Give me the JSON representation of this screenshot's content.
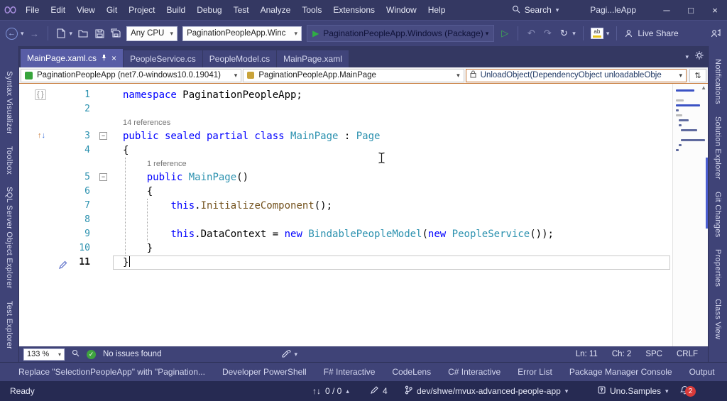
{
  "titlebar": {
    "menus": [
      "File",
      "Edit",
      "View",
      "Git",
      "Project",
      "Build",
      "Debug",
      "Test",
      "Analyze",
      "Tools",
      "Extensions",
      "Window",
      "Help"
    ],
    "search_label": "Search",
    "window_title": "Pagi...leApp"
  },
  "toolbar": {
    "platform": "Any CPU",
    "startup_project": "PaginationPeopleApp.Winc",
    "run_target": "PaginationPeopleApp.Windows (Package)",
    "live_share": "Live Share"
  },
  "doc_tabs": [
    {
      "label": "MainPage.xaml.cs",
      "active": true
    },
    {
      "label": "PeopleService.cs",
      "active": false
    },
    {
      "label": "PeopleModel.cs",
      "active": false
    },
    {
      "label": "MainPage.xaml",
      "active": false
    }
  ],
  "navbar": {
    "project": "PaginationPeopleApp (net7.0-windows10.0.19041)",
    "type": "PaginationPeopleApp.MainPage",
    "member": "UnloadObject(DependencyObject unloadableObje"
  },
  "left_tool_tabs": [
    "Syntax Visualizer",
    "Toolbox",
    "SQL Server Object Explorer",
    "Test Explorer"
  ],
  "right_tool_tabs": [
    "Notifications",
    "Solution Explorer",
    "Git Changes",
    "Properties",
    "Class View"
  ],
  "editor": {
    "colors": {
      "kw": "#0000ff",
      "ty": "#2b91af",
      "me": "#74531f",
      "pl": "#000000"
    },
    "code": [
      {
        "n": "1",
        "glyph": "ns",
        "segs": [
          [
            "kw",
            "namespace"
          ],
          [
            "pl",
            " PaginationPeopleApp;"
          ]
        ]
      },
      {
        "n": "2",
        "segs": []
      },
      {
        "lens": "14 references",
        "ind": 0
      },
      {
        "n": "3",
        "fold": true,
        "glyph": "inherit",
        "segs": [
          [
            "kw",
            "public sealed partial class"
          ],
          [
            "pl",
            " "
          ],
          [
            "ty",
            "MainPage"
          ],
          [
            "pl",
            " : "
          ],
          [
            "ty",
            "Page"
          ]
        ]
      },
      {
        "n": "4",
        "segs": [
          [
            "pl",
            "{"
          ]
        ]
      },
      {
        "lens": "1 reference",
        "ind": 1
      },
      {
        "n": "5",
        "fold": true,
        "segs": [
          [
            "pl",
            "    "
          ],
          [
            "kw",
            "public"
          ],
          [
            "pl",
            " "
          ],
          [
            "ty",
            "MainPage"
          ],
          [
            "pl",
            "()"
          ]
        ]
      },
      {
        "n": "6",
        "segs": [
          [
            "pl",
            "    {"
          ]
        ]
      },
      {
        "n": "7",
        "segs": [
          [
            "pl",
            "        "
          ],
          [
            "kw",
            "this"
          ],
          [
            "pl",
            "."
          ],
          [
            "me",
            "InitializeComponent"
          ],
          [
            "pl",
            "();"
          ]
        ]
      },
      {
        "n": "8",
        "segs": []
      },
      {
        "n": "9",
        "segs": [
          [
            "pl",
            "        "
          ],
          [
            "kw",
            "this"
          ],
          [
            "pl",
            ".DataContext = "
          ],
          [
            "kw",
            "new"
          ],
          [
            "pl",
            " "
          ],
          [
            "ty",
            "BindablePeopleModel"
          ],
          [
            "pl",
            "("
          ],
          [
            "kw",
            "new"
          ],
          [
            "pl",
            " "
          ],
          [
            "ty",
            "PeopleService"
          ],
          [
            "pl",
            "());"
          ]
        ]
      },
      {
        "n": "10",
        "segs": [
          [
            "pl",
            "    }"
          ]
        ]
      },
      {
        "n": "11",
        "current": true,
        "glyph": "pen",
        "cursor": true,
        "segs": [
          [
            "pl",
            "}"
          ]
        ]
      }
    ]
  },
  "editor_status": {
    "zoom": "133 %",
    "health": "No issues found",
    "line": "Ln: 11",
    "column": "Ch: 2",
    "spaces": "SPC",
    "line_ending": "CRLF"
  },
  "bottom_tabs": [
    "Replace \"SelectionPeopleApp\" with \"Pagination...",
    "Developer PowerShell",
    "F# Interactive",
    "CodeLens",
    "C# Interactive",
    "Error List",
    "Package Manager Console",
    "Output"
  ],
  "statusbar": {
    "ready": "Ready",
    "sync": "0 / 0",
    "edits": "4",
    "branch": "dev/shwe/mvux-advanced-people-app",
    "repo": "Uno.Samples",
    "notifications": "2"
  }
}
